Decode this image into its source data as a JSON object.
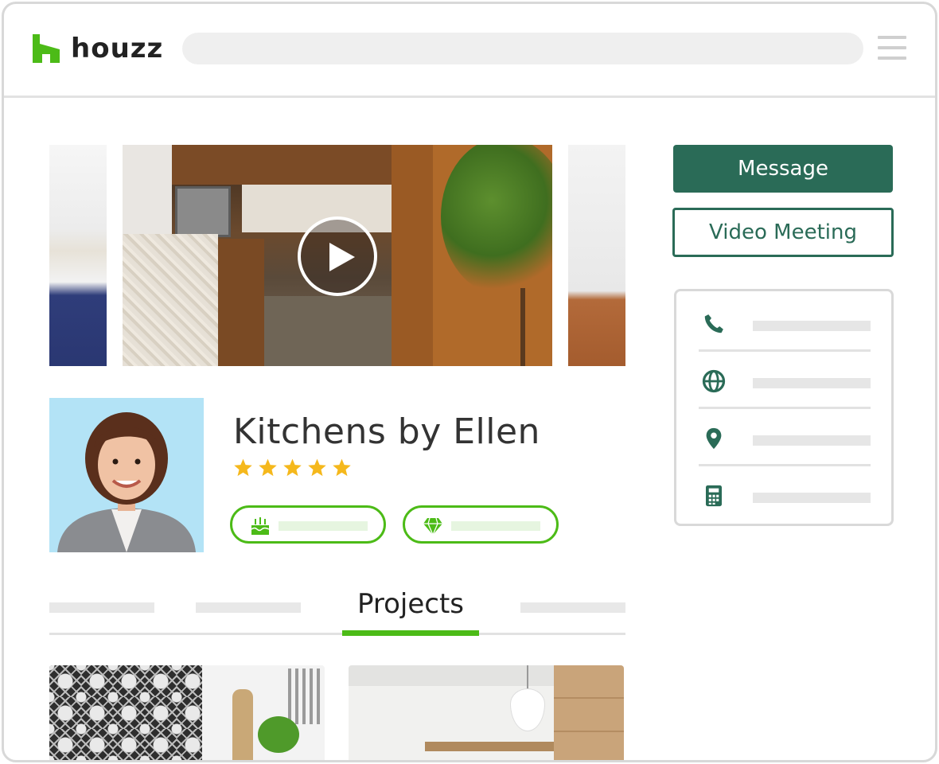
{
  "header": {
    "brand": "houzz",
    "logo_icon": "houzz-logo-icon",
    "menu_icon": "hamburger-menu-icon"
  },
  "colors": {
    "brand_green": "#4cbb17",
    "primary_dark_green": "#2a6b57",
    "star_yellow": "#f5b81c"
  },
  "gallery": {
    "play_icon": "play-icon"
  },
  "profile": {
    "name": "Kitchens by Ellen",
    "rating": 5,
    "rating_max": 5,
    "badges": [
      {
        "icon": "anniversary-cake-icon"
      },
      {
        "icon": "diamond-icon"
      }
    ]
  },
  "tabs": {
    "active_label": "Projects"
  },
  "actions": {
    "message_label": "Message",
    "video_meeting_label": "Video Meeting"
  },
  "contact": {
    "rows": [
      {
        "icon": "phone-icon"
      },
      {
        "icon": "globe-icon"
      },
      {
        "icon": "location-pin-icon"
      },
      {
        "icon": "calculator-icon"
      }
    ]
  }
}
